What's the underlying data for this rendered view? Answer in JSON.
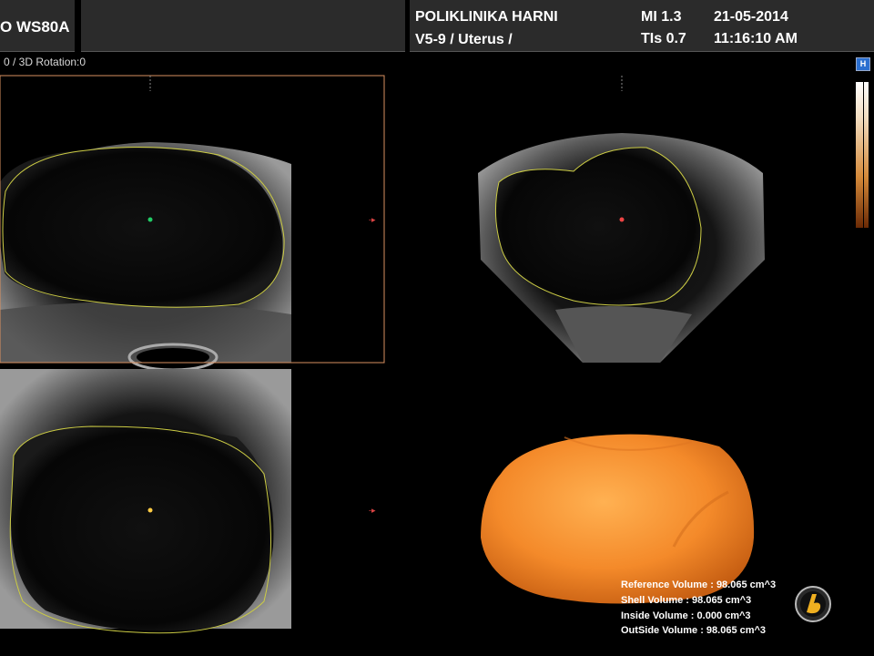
{
  "header": {
    "model": "O WS80A",
    "hospital": "POLIKLINIKA HARNI",
    "probe_preset": "V5-9 / Uterus /",
    "mi": "MI  1.3",
    "tis": "TIs 0.7",
    "date": "21-05-2014",
    "time": "11:16:10 AM"
  },
  "status_line": "0 / 3D Rotation:0",
  "help_icon_label": "H",
  "icons": {
    "help": "help-icon",
    "logo": "vendor-logo-icon"
  },
  "colors": {
    "header_bg": "#2b2b2b",
    "active_frame": "#d99060",
    "outline": "#d6d64a",
    "volume_render": "#f0892c"
  },
  "volume": {
    "reference": "Reference Volume : 98.065 cm^3",
    "shell": "Shell Volume : 98.065 cm^3",
    "inside": "Inside Volume : 0.000 cm^3",
    "outside": "OutSide Volume : 98.065 cm^3"
  }
}
